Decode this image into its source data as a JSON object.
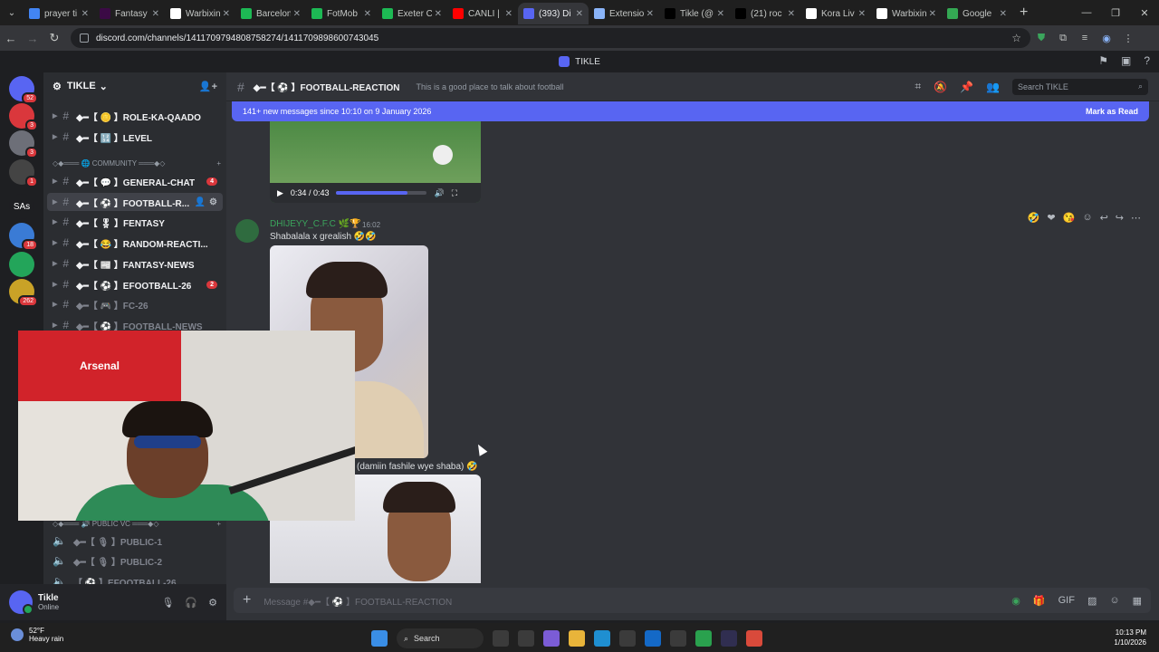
{
  "browser": {
    "tabs": [
      {
        "label": "prayer ti",
        "color": "#4285f4"
      },
      {
        "label": "Fantasy",
        "color": "#3b0a45"
      },
      {
        "label": "Warbixin",
        "color": "#ffffff"
      },
      {
        "label": "Barcelon",
        "color": "#1db954"
      },
      {
        "label": "FotMob",
        "color": "#1db954"
      },
      {
        "label": "Exeter C",
        "color": "#1db954"
      },
      {
        "label": "CANLI |",
        "color": "#ff0000"
      },
      {
        "label": "(393) Di",
        "color": "#5865f2"
      },
      {
        "label": "Extensio",
        "color": "#8ab4f8"
      },
      {
        "label": "Tikle (@",
        "color": "#000000"
      },
      {
        "label": "(21) roc",
        "color": "#000000"
      },
      {
        "label": "Kora Liv",
        "color": "#ffffff"
      },
      {
        "label": "Warbixin",
        "color": "#ffffff"
      },
      {
        "label": "Google",
        "color": "#34a853"
      }
    ],
    "active_tab_index": 7,
    "url": "discord.com/channels/1411709794808758274/1411709898600743045"
  },
  "discord": {
    "window_title": "TIKLE",
    "rail": [
      {
        "label": "",
        "badge": "52",
        "color": "#5865f2"
      },
      {
        "label": "",
        "badge": "3",
        "color": "#da373c"
      },
      {
        "label": "",
        "badge": "3",
        "color": "#6d6f78"
      },
      {
        "label": "",
        "badge": "1",
        "color": "#444"
      },
      {
        "label": "SAs",
        "badge": "",
        "color": "#1e1f22"
      },
      {
        "label": "",
        "badge": "18",
        "color": "#3a7bd5"
      },
      {
        "label": "",
        "badge": "",
        "color": "#23a55a"
      },
      {
        "label": "",
        "badge": "262",
        "color": "#c9a227"
      }
    ],
    "server_name": "TIKLE",
    "channels": [
      {
        "name": "◆━【 🪙 】ROLE-KA-QAADO",
        "dim": false,
        "badge": ""
      },
      {
        "name": "◆━【 🔢 】LEVEL",
        "dim": false,
        "badge": ""
      },
      {
        "name": "◆━【 💬 】GENERAL-CHAT",
        "dim": false,
        "badge": "4"
      },
      {
        "name": "◆━【 ⚽ 】FOOTBALL-R...",
        "dim": false,
        "badge": "",
        "active": true
      },
      {
        "name": "◆━【 🎖 】FENTASY",
        "dim": false,
        "badge": ""
      },
      {
        "name": "◆━【 😂 】RANDOM-REACTI...",
        "dim": false,
        "badge": ""
      },
      {
        "name": "◆━【 📰 】FANTASY-NEWS",
        "dim": false,
        "badge": ""
      },
      {
        "name": "◆━【 ⚽ 】EFOOTBALL-26",
        "dim": false,
        "badge": "2"
      },
      {
        "name": "◆━【 🎮 】FC-26",
        "dim": true,
        "badge": ""
      },
      {
        "name": "◆━【 ⚽ 】FOOTBALL-NEWS",
        "dim": true,
        "badge": ""
      }
    ],
    "community_label": "◇◆═══ 🌐 COMMUNITY ═══◆◇",
    "public_vc_label": "◇◆═══ 🔊 PUBLIC VC ═══◆◇",
    "voice_channels": [
      {
        "name": "◆━【 🎙 】PUBLIC-1"
      },
      {
        "name": "◆━【 🎙 】PUBLIC-2"
      },
      {
        "name": "【 ⚽ 】EFOOTBALL-26"
      }
    ],
    "user": {
      "name": "Tikle",
      "status": "Online"
    },
    "channel_header": {
      "name": "◆━【 ⚽ 】FOOTBALL-REACTION",
      "topic": "This is a good place to talk about football",
      "search_placeholder": "Search TIKLE"
    },
    "new_messages": {
      "text": "141+ new messages since 10:10 on 9 January 2026",
      "action": "Mark as Read"
    },
    "video_player": {
      "time": "0:34 / 0:43",
      "progress": 0.79
    },
    "message1": {
      "author": "DHIJEYY_C.F.C 🌿🏆",
      "time": "16:02",
      "content": "Shabalala x grealish 🤣🤣"
    },
    "message2": {
      "content": "(damiin fashile wye shaba) 🤣"
    },
    "composer_placeholder": "Message #◆━【 ⚽ 】FOOTBALL-REACTION",
    "webcam": {
      "flag_text": "Arsenal"
    }
  },
  "taskbar": {
    "weather_temp": "52°F",
    "weather_desc": "Heavy rain",
    "search_label": "Search",
    "time": "10:13 PM",
    "date": "1/10/2026"
  },
  "colors": {
    "blurple": "#5865f2",
    "online": "#23a55a",
    "badge": "#da373c"
  }
}
